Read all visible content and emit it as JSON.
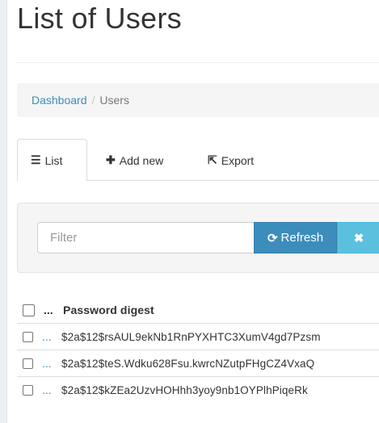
{
  "page": {
    "title": "List of Users"
  },
  "breadcrumb": {
    "items": [
      "Dashboard",
      "Users"
    ],
    "separator": "/"
  },
  "tabs": [
    {
      "label": "List",
      "icon": "list-icon",
      "active": true
    },
    {
      "label": "Add new",
      "icon": "plus-icon",
      "active": false
    },
    {
      "label": "Export",
      "icon": "export-icon",
      "active": false
    }
  ],
  "filter": {
    "placeholder": "Filter",
    "value": "",
    "refresh_label": "Refresh",
    "clear_icon": "close-icon"
  },
  "table": {
    "column_header": "Password digest",
    "ellipsis_header": "...",
    "rows": [
      {
        "link": "...",
        "digest": "$2a$12$rsAUL9ekNb1RnPYXHTC3XumV4gd7Pzsm"
      },
      {
        "link": "...",
        "digest": "$2a$12$teS.Wdku628Fsu.kwrcNZutpFHgCZ4VxaQ"
      },
      {
        "link": "...",
        "digest": "$2a$12$kZEa2UzvHOHhh3yoy9nb1OYPlhPiqeRk"
      }
    ]
  },
  "colors": {
    "link": "#3c8dbc",
    "refresh": "#3c8dbc",
    "clear": "#5bc0de",
    "well": "#f5f5f5"
  }
}
